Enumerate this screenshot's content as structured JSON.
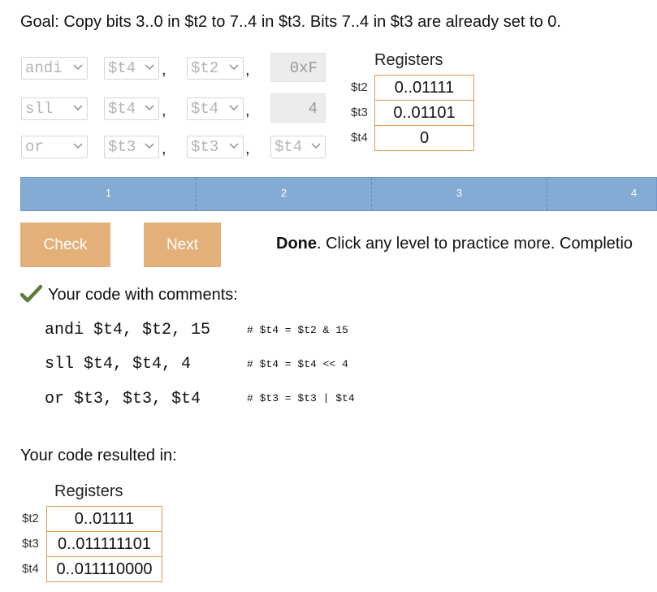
{
  "goal": "Goal: Copy bits 3..0 in $t2 to 7..4 in $t3. Bits 7..4 in $t3 are already set to 0.",
  "instructions": [
    {
      "op": "andi",
      "a": "$t4",
      "b": "$t2",
      "c": "0xF",
      "c_type": "immediate"
    },
    {
      "op": "sll",
      "a": "$t4",
      "b": "$t4",
      "c": "4",
      "c_type": "immediate"
    },
    {
      "op": "or",
      "a": "$t3",
      "b": "$t3",
      "c": "$t4",
      "c_type": "register"
    }
  ],
  "comma": ",",
  "registers_top": {
    "title": "Registers",
    "rows": [
      {
        "name": "$t2",
        "value": "0..01111"
      },
      {
        "name": "$t3",
        "value": "0..01101"
      },
      {
        "name": "$t4",
        "value": "0"
      }
    ]
  },
  "levels": [
    "1",
    "2",
    "3",
    "4"
  ],
  "buttons": {
    "check": "Check",
    "next": "Next"
  },
  "status": {
    "bold": "Done",
    "rest": ". Click any level to practice more. Completio"
  },
  "code_header": "Your code with comments:",
  "code_lines": [
    {
      "code": "andi $t4, $t2, 15",
      "comment": "# $t4 = $t2 & 15"
    },
    {
      "code": "sll $t4, $t4, 4",
      "comment": "# $t4 = $t4 << 4"
    },
    {
      "code": "or $t3, $t3, $t4",
      "comment": "# $t3 = $t3 | $t4"
    }
  ],
  "result_header": "Your code resulted in:",
  "registers_result": {
    "title": "Registers",
    "rows": [
      {
        "name": "$t2",
        "value": "0..01111"
      },
      {
        "name": "$t3",
        "value": "0..011111101"
      },
      {
        "name": "$t4",
        "value": "0..011110000"
      }
    ]
  },
  "colors": {
    "accent": "#e4b07a",
    "level_bar": "#84abd3",
    "check": "#5c7c3a",
    "register_border": "#e09a52"
  }
}
